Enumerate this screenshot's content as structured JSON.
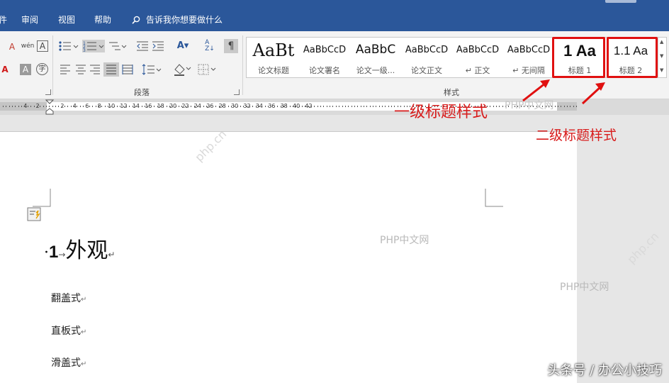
{
  "menu": {
    "items": [
      "件",
      "审阅",
      "视图",
      "帮助"
    ],
    "tell_me": "告诉我你想要做什么"
  },
  "ribbon": {
    "paragraph_label": "段落",
    "styles_label": "样式",
    "pinyin_label": "wén",
    "styles": [
      {
        "sample": "AaBt",
        "name": "论文标题"
      },
      {
        "sample": "AaBbCcD",
        "name": "论文署名"
      },
      {
        "sample": "AaBbC",
        "name": "论文一级..."
      },
      {
        "sample": "AaBbCcD",
        "name": "论文正文"
      },
      {
        "sample": "AaBbCcD",
        "name": "↵ 正文"
      },
      {
        "sample": "AaBbCcD",
        "name": "↵ 无间隔"
      },
      {
        "sample": "1  Aa",
        "name": "标题 1"
      },
      {
        "sample": "1.1  Aa",
        "name": "标题 2"
      }
    ]
  },
  "ruler": {
    "numbers": [
      "4",
      "2",
      "2",
      "4",
      "6",
      "8",
      "10",
      "12",
      "14",
      "16",
      "18",
      "20",
      "22",
      "24",
      "26",
      "28",
      "30",
      "32",
      "34",
      "36",
      "38",
      "40",
      "42"
    ]
  },
  "document": {
    "heading_number": "1",
    "heading_arrow": "→",
    "heading_text": "外观",
    "para_mark": "↵",
    "lines": [
      "翻盖式",
      "直板式",
      "滑盖式"
    ]
  },
  "annotations": {
    "level1": "一级标题样式",
    "level2": "二级标题样式"
  },
  "watermarks": [
    "PHP中文网",
    "PHP中文网",
    "PHP中文网",
    "php.cn",
    "php.cn"
  ],
  "credit": "头条号 / 办公小技巧",
  "colors": {
    "accent": "#2b579a",
    "highlight": "#e01010",
    "annotation": "#d81c1c"
  },
  "icons": [
    "font-color-eraser-icon",
    "phonetic-guide-icon",
    "character-border-icon",
    "bullets-icon",
    "numbering-icon",
    "multilevel-list-icon",
    "decrease-indent-icon",
    "increase-indent-icon",
    "chinese-layout-icon",
    "sort-icon",
    "show-marks-icon",
    "font-color-icon",
    "character-shading-icon",
    "enclose-characters-icon",
    "align-left-icon",
    "center-icon",
    "align-right-icon",
    "justify-icon",
    "distributed-icon",
    "line-spacing-icon",
    "shading-icon",
    "borders-icon"
  ]
}
